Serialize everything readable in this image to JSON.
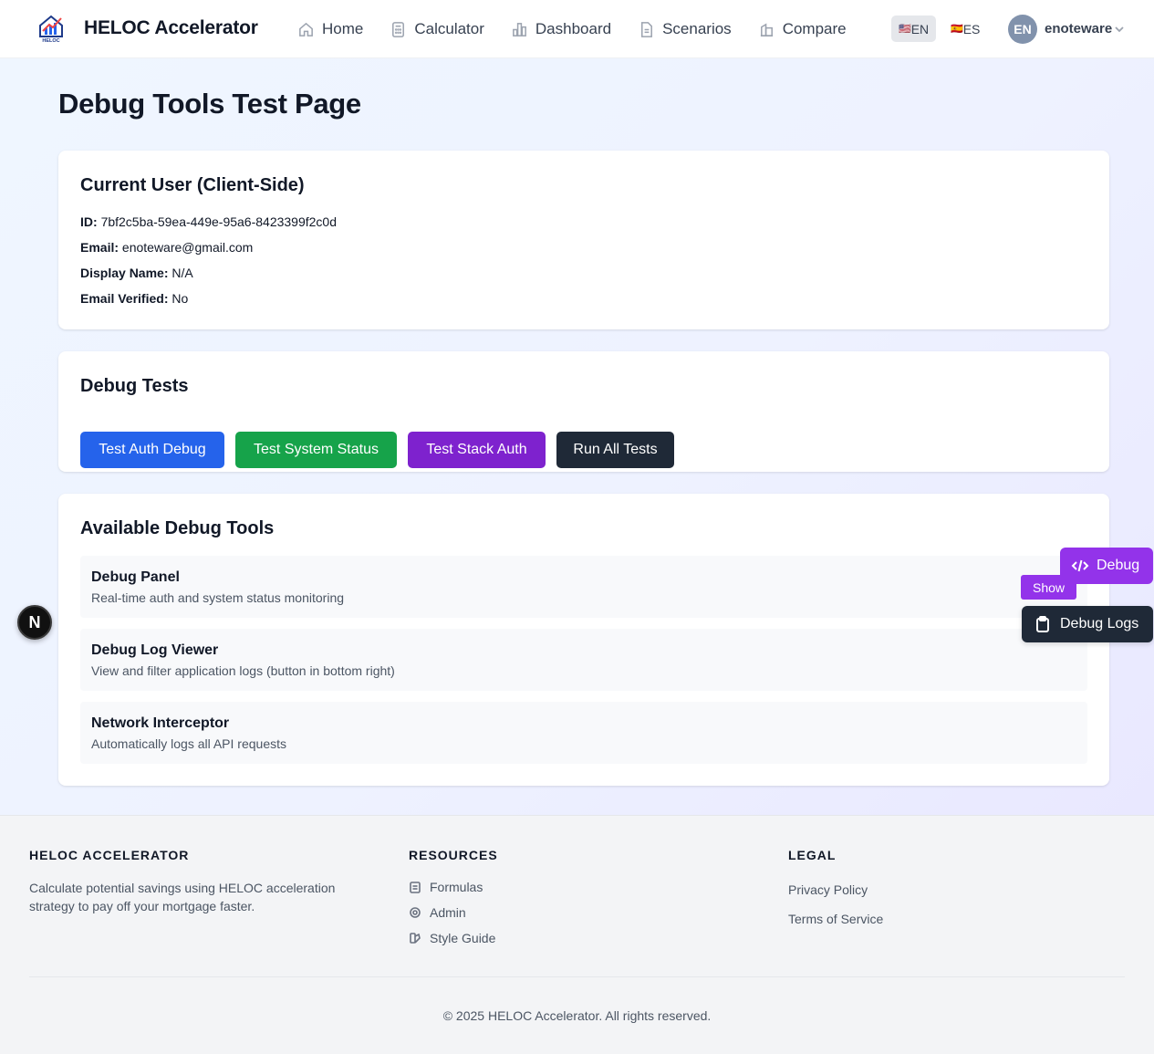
{
  "header": {
    "brand": "HELOC Accelerator",
    "logo_text": "HELOC",
    "nav": [
      {
        "label": "Home",
        "icon": "home-icon"
      },
      {
        "label": "Calculator",
        "icon": "calculator-icon"
      },
      {
        "label": "Dashboard",
        "icon": "bar-chart-icon"
      },
      {
        "label": "Scenarios",
        "icon": "document-icon"
      },
      {
        "label": "Compare",
        "icon": "compare-icon"
      }
    ],
    "languages": [
      {
        "flag": "🇺🇸",
        "code": "EN",
        "active": true
      },
      {
        "flag": "🇪🇸",
        "code": "ES",
        "active": false
      }
    ],
    "avatar_initials": "EN",
    "username": "enoteware"
  },
  "page": {
    "title": "Debug Tools Test Page"
  },
  "user_card": {
    "title": "Current User (Client-Side)",
    "fields": [
      {
        "label": "ID:",
        "value": "7bf2c5ba-59ea-449e-95a6-8423399f2c0d"
      },
      {
        "label": "Email:",
        "value": "enoteware@gmail.com"
      },
      {
        "label": "Display Name:",
        "value": "N/A"
      },
      {
        "label": "Email Verified:",
        "value": "No"
      }
    ]
  },
  "tests_card": {
    "title": "Debug Tests",
    "buttons": [
      {
        "label": "Test Auth Debug",
        "color": "#2563eb"
      },
      {
        "label": "Test System Status",
        "color": "#16a34a"
      },
      {
        "label": "Test Stack Auth",
        "color": "#7e22ce"
      },
      {
        "label": "Run All Tests",
        "color": "#1f2937"
      }
    ]
  },
  "tools_card": {
    "title": "Available Debug Tools",
    "tools": [
      {
        "name": "Debug Panel",
        "description": "Real-time auth and system status monitoring"
      },
      {
        "name": "Debug Log Viewer",
        "description": "View and filter application logs (button in bottom right)"
      },
      {
        "name": "Network Interceptor",
        "description": "Automatically logs all API requests"
      }
    ]
  },
  "floating": {
    "debug_label": "Debug",
    "show_label": "Show",
    "logs_label": "Debug Logs",
    "next_badge": "N"
  },
  "footer": {
    "about_heading": "HELOC ACCELERATOR",
    "about_text": "Calculate potential savings using HELOC acceleration strategy to pay off your mortgage faster.",
    "resources_heading": "RESOURCES",
    "resources": [
      {
        "label": "Formulas",
        "icon": "clipboard-icon"
      },
      {
        "label": "Admin",
        "icon": "gear-icon"
      },
      {
        "label": "Style Guide",
        "icon": "palette-icon"
      }
    ],
    "legal_heading": "LEGAL",
    "legal": [
      {
        "label": "Privacy Policy"
      },
      {
        "label": "Terms of Service"
      }
    ],
    "copyright": "© 2025 HELOC Accelerator. All rights reserved."
  }
}
